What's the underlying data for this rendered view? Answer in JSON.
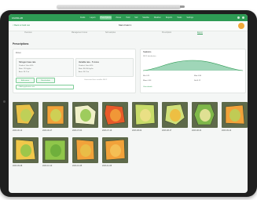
{
  "app": {
    "brand": "FARMLAB",
    "nav": [
      "Fields",
      "Layers",
      "Prescriptions",
      "Zones",
      "Yield",
      "Soil",
      "Satellite",
      "Weather",
      "Reports",
      "Tasks",
      "Settings"
    ],
    "active_nav_index": 2,
    "accent_color": "#2e9b54"
  },
  "subheader": {
    "back_label": "< Back to Field List",
    "field_title": "Main Field 1",
    "tabs": [
      "Overview",
      "Management zones",
      "Soil samples",
      "Prescription",
      "Export"
    ],
    "active_tab_index": 4
  },
  "section_title": "Prescriptions",
  "zones_panel": {
    "label": "Zones",
    "cards": [
      {
        "title": "Nitrogen base rate",
        "lines": [
          "Product: Urea 46%",
          "Rate: 120 kg/ha",
          "Area: 34.2 ha"
        ]
      },
      {
        "title": "Variable rate - 5 zones",
        "lines": [
          "Product: Urea 46%",
          "Rate: 80-160 kg/ha",
          "Area: 34.2 ha"
        ]
      }
    ],
    "buttons": [
      "Edit zones",
      "Recalculate"
    ],
    "add_label": "+ Add application rate",
    "note": "Generated from satellite NDVI"
  },
  "stats_panel": {
    "title": "Statistics",
    "subtitle": "NDVI distribution",
    "rows": [
      {
        "label": "Min",
        "value": "0.21"
      },
      {
        "label": "Max",
        "value": "0.86"
      },
      {
        "label": "Mean",
        "value": "0.54"
      },
      {
        "label": "Std",
        "value": "0.12"
      }
    ],
    "footer": "View details"
  },
  "thumbnails": [
    {
      "label": "2023-06-12",
      "colors": [
        "#e8c24a",
        "#b7d25a"
      ]
    },
    {
      "label": "2023-06-27",
      "colors": [
        "#f2a23a",
        "#c8d85a"
      ]
    },
    {
      "label": "2023-07-04",
      "colors": [
        "#f0f0c8",
        "#8fc64a"
      ]
    },
    {
      "label": "2023-07-19",
      "colors": [
        "#e85a2a",
        "#f2a23a"
      ]
    },
    {
      "label": "2023-08-02",
      "colors": [
        "#c8dc6a",
        "#f0e08a"
      ]
    },
    {
      "label": "2023-08-17",
      "colors": [
        "#d0e07a",
        "#f2b83a"
      ]
    },
    {
      "label": "2023-08-31",
      "colors": [
        "#7fb84a",
        "#f0e6a0"
      ]
    },
    {
      "label": "2023-09-14",
      "colors": [
        "#f2a23a",
        "#b7d25a"
      ]
    },
    {
      "label": "2023-09-28",
      "colors": [
        "#f0c84a",
        "#8fc64a"
      ]
    },
    {
      "label": "2023-10-10",
      "colors": [
        "#8fc64a",
        "#6aaa3a"
      ]
    },
    {
      "label": "2023-10-25",
      "colors": [
        "#f2a23a",
        "#e8c24a"
      ]
    },
    {
      "label": "2023-11-08",
      "colors": [
        "#f2a23a",
        "#f5c45a"
      ]
    }
  ]
}
